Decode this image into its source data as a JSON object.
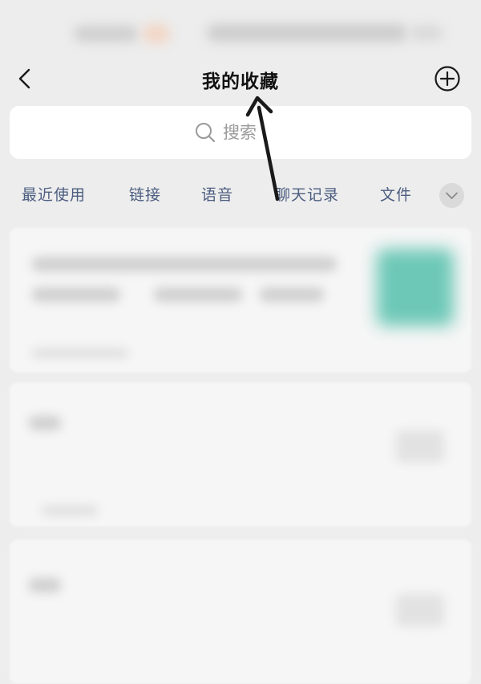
{
  "header": {
    "title": "我的收藏",
    "back_icon": "chevron-left-icon",
    "add_icon": "plus-circle-icon"
  },
  "search": {
    "placeholder": "搜索",
    "icon": "search-icon"
  },
  "filters": {
    "items": [
      "最近使用",
      "链接",
      "语音",
      "聊天记录",
      "文件"
    ],
    "expand_icon": "chevron-down-icon"
  },
  "annotation": {
    "arrow_color": "#1a1a1a"
  },
  "colors": {
    "background": "#ededed",
    "card": "#f6f6f6",
    "filter_text": "#4c5d80",
    "thumbnail_accent": "#6dc8b7"
  }
}
